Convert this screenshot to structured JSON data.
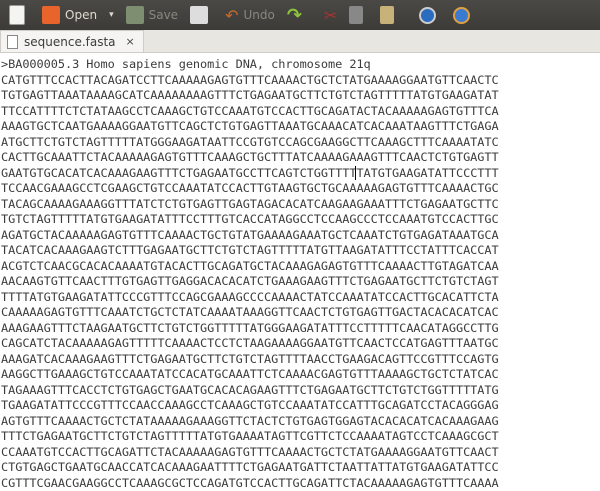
{
  "toolbar": {
    "open": "Open",
    "save": "Save",
    "undo": "Undo"
  },
  "tab": {
    "title": "sequence.fasta",
    "close": "×"
  },
  "document": {
    "header": ">BA000005.3 Homo sapiens genomic DNA, chromosome 21q",
    "lines": [
      "CATGTTTCCACTTACAGATCCTTCAAAAAGAGTGTTTCAAAACTGCTCTATGAAAAGGAATGTTCAACTC",
      "TGTGAGTTAAATAAAAGCATCAAAAAAAAGTTTCTGAGAATGCTTCTGTCTAGTTTTTATGTGAAGATAT",
      "TTCCATTTTCTCTATAAGCCTCAAAGCTGTCCAAATGTCCACTTGCAGATACTACAAAAAGAGTGTTTCA",
      "AAAGTGCTCAATGAAAAGGAATGTTCAGCTCTGTGAGTTAAATGCAAACATCACAAATAAGTTTCTGAGA",
      "ATGCTTCTGTCTAGTTTTTATGGGAAGATAATTCCGTGTCCAGCGAAGGCTTCAAAGCTTTCAAAATATC",
      "CACTTGCAAATTCTACAAAAAGAGTGTTTCAAAGCTGCTTTATCAAAAGAAAGTTTCAACTCTGTGAGTT",
      "GAATGTGCACATCACAAAGAAGTTTCTGAGAATGCCTTCAGTCTGGTTTTTATGTGAAGATATTCCCTTT",
      "TCCAACGAAAGCCTCGAAGCTGTCCAAATATCCACTTGTAAGTGCTGCAAAAAGAGTGTTTCAAAACTGC",
      "TACAGCAAAAGAAAGGTTTATCTCTGTGAGTTGAGTAGACACATCAAGAAGAAATTTCTGAGAATGCTTC",
      "TGTCTAGTTTTTATGTGAAGATATTTCCTTTGTCACCATAGGCCTCCAAGCCCTCCAAATGTCCACTTGC",
      "AGATGCTACAAAAAGAGTGTTTCAAAACTGCTGTATGAAAAGAAATGCTCAAATCTGTGAGATAAATGCA",
      "TACATCACAAAGAAGTCTTTGAGAATGCTTCTGTCTAGTTTTTATGTTAAGATATTTCCTATTTCACCAT",
      "ACGTCTCAACGCACACAAAATGTACACTTGCAGATGCTACAAAGAGAGTGTTTCAAAACTTGTAGATCAA",
      "AACAAGTGTTCAACTTTGTGAGTTGAGGACACACATCTGAAAGAAGTTTCTGAGAATGCTTCTGTCTAGT",
      "TTTTATGTGAAGATATTCCCGTTTCCAGCGAAAGCCCCAAAACTATCCAAATATCCACTTGCACATTCTA",
      "CAAAAAGAGTGTTTCAAATCTGCTCTATCAAAATAAAGGTTCAACTCTGTGAGTTGACTACACACATCAC",
      "AAAGAAGTTTCTAAGAATGCTTCTGTCTGGTTTTTATGGGAAGATATTTCCTTTTTCAACATAGGCCTTG",
      "CAGCATCTACAAAAAGAGTTTTTCAAAACTCCTCTAAGAAAAGGAATGTTCAACTCCATGAGTTTAATGC",
      "AAAGATCACAAAGAAGTTTCTGAGAATGCTTCTGTCTAGTTTTAACCTGAAGACAGTTCCGTTTCCAGTG",
      "AAGGCTTGAAAGCTGTCCAAATATCCACATGCAAATTCTCAAAACGAGTGTTTAAAAGCTGCTCTATCAC",
      "TAGAAAGTTTCACCTCTGTGAGCTGAATGCACACAGAAGTTTCTGAGAATGCTTCTGTCTGGTTTTTATG",
      "TGAAGATATTCCCGTTTCCAACCAAAGCCTCAAAGCTGTCCAAATATCCATTTGCAGATCCTACAGGGAG",
      "AGTGTTTCAAAACTGCTCTATAAAAAGAAAGGTTCTACTCTGTGAGTGGAGTACACACATCACAAAGAAG",
      "TTTCTGAGAATGCTTCTGTCTAGTTTTTATGTGAAAATAGTTCGTTCTCCAAAATAGTCCTCAAAGCGCT",
      "CCAAATGTCCACTTGCAGATTCTACAAAAAGAGTGTTTCAAAACTGCTCTATGAAAAGGAATGTTCAACT",
      "CTGTGAGCTGAATGCAACCATCACAAAGAATTTTCTGAGAATGATTCTAATTATTATGTGAAGATATTCC",
      "CGTTTCGAACGAAGGCCTCAAAGCGCTCCAGATGTCCACTTGCAGATTCTACAAAAAGAGTGTTTCAAAA"
    ]
  }
}
